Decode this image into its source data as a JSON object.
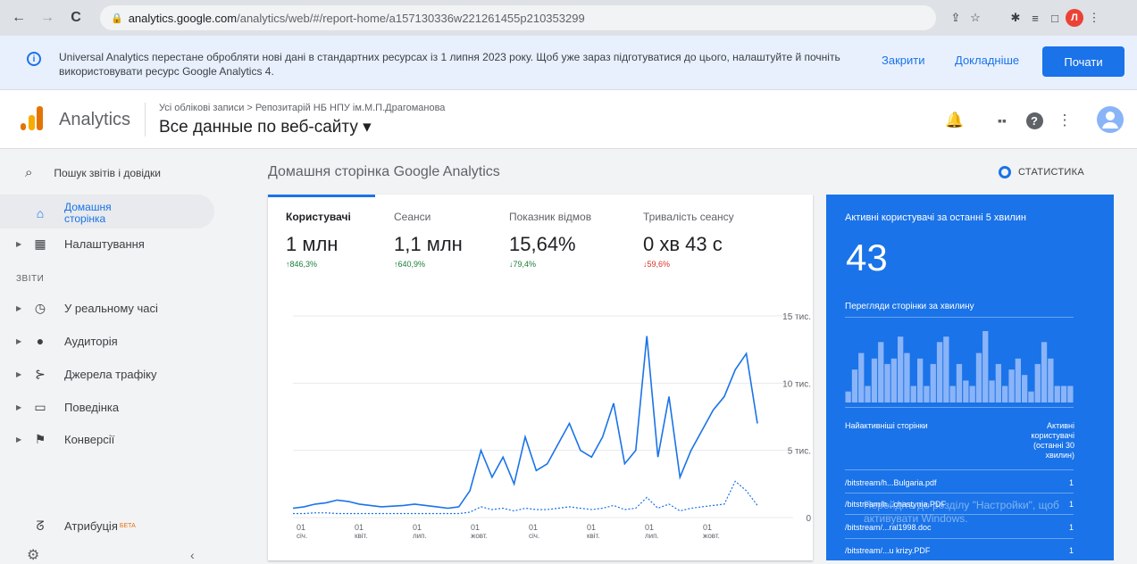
{
  "browser": {
    "url_domain": "analytics.google.com",
    "url_path": "/analytics/web/#/report-home/a157130336w221261455p210353299",
    "profile_initial": "Л"
  },
  "banner": {
    "message": "Universal Analytics перестане обробляти нові дані в стандартних ресурсах із 1 липня 2023 року. Щоб уже зараз підготуватися до цього, налаштуйте й почніть використовувати ресурс Google Analytics 4.",
    "close_label": "Закрити",
    "details_label": "Докладніше",
    "start_label": "Почати"
  },
  "header": {
    "app_name": "Analytics",
    "breadcrumb": "Усі облікові записи > Репозитарій НБ НПУ ім.М.П.Драгоманова",
    "view_name": "Все данные по веб-сайту ▾"
  },
  "sidebar": {
    "search_placeholder": "Пошук звітів і довідки",
    "section_label": "ЗВІТИ",
    "items": [
      {
        "label": "Домашня сторінка",
        "icon": "home-icon"
      },
      {
        "label": "Налаштування",
        "icon": "dashboard-icon"
      },
      {
        "label": "У реальному часі",
        "icon": "clock-icon"
      },
      {
        "label": "Аудиторія",
        "icon": "person-icon"
      },
      {
        "label": "Джерела трафіку",
        "icon": "acquisition-icon"
      },
      {
        "label": "Поведінка",
        "icon": "behavior-icon"
      },
      {
        "label": "Конверсії",
        "icon": "flag-icon"
      },
      {
        "label": "Атрибуція",
        "icon": "attribution-icon",
        "badge": "БЕТА"
      }
    ]
  },
  "main": {
    "title": "Домашня сторінка Google Analytics",
    "stats_link": "СТАТИСТИКА",
    "metrics": [
      {
        "label": "Користувачі",
        "value": "1 млн",
        "delta": "↑846,3%",
        "color": "#188038"
      },
      {
        "label": "Сеанси",
        "value": "1,1 млн",
        "delta": "↑640,9%",
        "color": "#188038"
      },
      {
        "label": "Показник відмов",
        "value": "15,64%",
        "delta": "↓79,4%",
        "color": "#188038"
      },
      {
        "label": "Тривалість сеансу",
        "value": "0 хв 43 с",
        "delta": "↓59,6%",
        "color": "#d93025"
      }
    ]
  },
  "chart_data": {
    "type": "line",
    "y_ticks": [
      "15 тис.",
      "10 тис.",
      "5 тис.",
      "0"
    ],
    "x_ticks": [
      {
        "day": "01",
        "month": "січ."
      },
      {
        "day": "01",
        "month": "квіт."
      },
      {
        "day": "01",
        "month": "лип."
      },
      {
        "day": "01",
        "month": "жовт."
      },
      {
        "day": "01",
        "month": "січ."
      },
      {
        "day": "01",
        "month": "квіт."
      },
      {
        "day": "01",
        "month": "лип."
      },
      {
        "day": "01",
        "month": "жовт."
      }
    ],
    "ylim": [
      0,
      15000
    ],
    "series": [
      {
        "color": "#1a73e8",
        "style": "solid",
        "values": [
          700,
          800,
          1000,
          1100,
          1300,
          1200,
          1000,
          900,
          800,
          850,
          900,
          1000,
          900,
          800,
          700,
          800,
          2000,
          5000,
          3000,
          4500,
          2500,
          6000,
          3500,
          4000,
          5500,
          7000,
          5000,
          4500,
          6000,
          8500,
          4000,
          5000,
          13500,
          4500,
          9000,
          3000,
          5000,
          6500,
          8000,
          9000,
          11000,
          12200,
          7000
        ]
      },
      {
        "color": "#1a73e8",
        "style": "dashed",
        "values": [
          300,
          300,
          350,
          350,
          300,
          300,
          300,
          300,
          300,
          300,
          300,
          300,
          300,
          300,
          300,
          300,
          400,
          800,
          600,
          700,
          500,
          700,
          600,
          600,
          700,
          800,
          700,
          600,
          700,
          900,
          600,
          700,
          1500,
          700,
          1000,
          500,
          700,
          800,
          900,
          1000,
          2700,
          2000,
          900
        ]
      }
    ]
  },
  "realtime": {
    "title": "Активні користувачі за останні 5 хвилин",
    "count": "43",
    "sub_title": "Перегляди сторінки за хвилину",
    "bars": [
      2,
      6,
      9,
      3,
      8,
      11,
      7,
      8,
      12,
      9,
      3,
      8,
      3,
      7,
      11,
      12,
      3,
      7,
      4,
      3,
      9,
      13,
      4,
      7,
      3,
      6,
      8,
      5,
      2,
      7,
      11,
      8,
      3,
      3,
      3
    ],
    "table_header_left": "Найактивніші сторінки",
    "table_header_right": "Активні користувачі (останні 30 хвилин)",
    "rows": [
      {
        "page": "/bitstream/h...Bulgaria.pdf",
        "count": "1"
      },
      {
        "page": "/bitstream/h...chastynia.PDF",
        "count": "1"
      },
      {
        "page": "/bitstream/...ral1998.doc",
        "count": "1"
      },
      {
        "page": "/bitstream/...u krizy.PDF",
        "count": "1"
      }
    ],
    "watermark": "Перейдіть до розділу \"Настройки\", щоб активувати Windows."
  }
}
